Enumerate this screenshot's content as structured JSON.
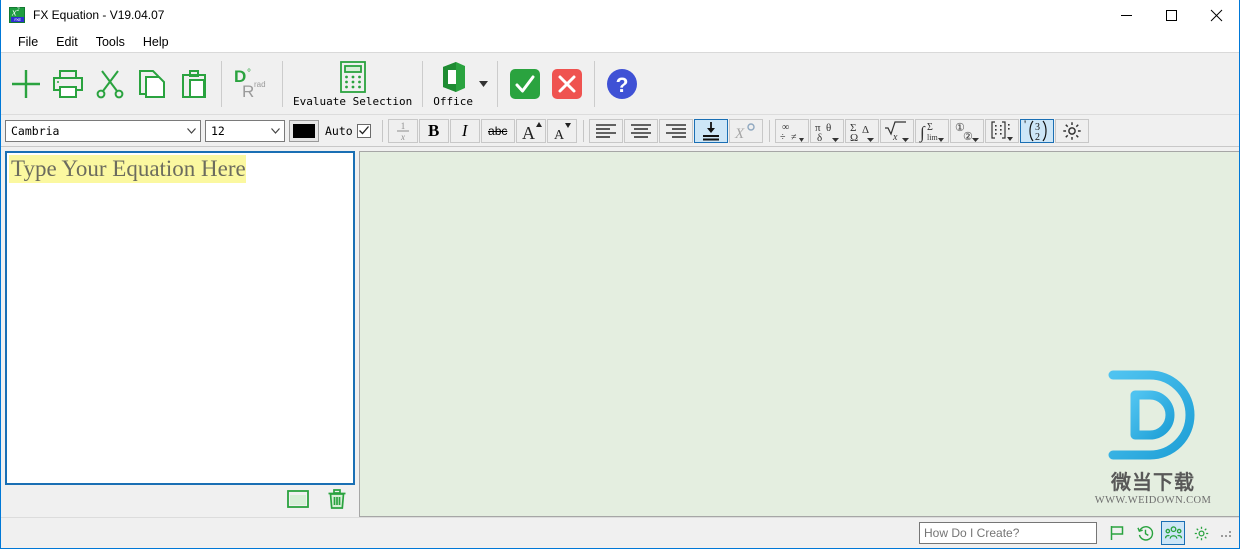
{
  "window": {
    "title": "FX Equation - V19.04.07",
    "app_icon": "fx-equation-icon",
    "minimize": "minimize",
    "maximize": "maximize",
    "close": "close"
  },
  "menu": {
    "items": [
      {
        "label": "File"
      },
      {
        "label": "Edit"
      },
      {
        "label": "Tools"
      },
      {
        "label": "Help"
      }
    ]
  },
  "toolbar": {
    "new_label": "",
    "print_label": "",
    "cut_label": "",
    "copy_label": "",
    "paste_label": "",
    "angle_mode": {
      "degrees": "D",
      "degree_symbol": "°",
      "radians": "R",
      "radian_label": "rad"
    },
    "evaluate_label": "Evaluate Selection",
    "office_label": "Office",
    "accept_label": "",
    "cancel_label": "",
    "help_label": ""
  },
  "formatbar": {
    "font_name": "Cambria",
    "font_size": "12",
    "color_value": "#000000",
    "auto_label": "Auto",
    "auto_checked": true,
    "bold_label": "B",
    "italic_label": "I",
    "strike_label": "abc",
    "grow_label": "A",
    "shrink_label": "A",
    "superscript_label": "X",
    "degree_label": "°",
    "fraction_numerator": "1",
    "fraction_denominator": "x",
    "symbols": {
      "operators": [
        "∞",
        "÷",
        "≠"
      ],
      "greek_lower": [
        "π",
        "θ",
        "δ"
      ],
      "greek_upper": [
        "Σ",
        "Ω",
        "Δ"
      ],
      "roots": [
        "√x",
        "x"
      ],
      "calculus": [
        "∫",
        "Σ",
        "lim"
      ],
      "circled": [
        "①",
        "②"
      ],
      "matrix": "matrix"
    },
    "binomial": {
      "top": "3",
      "bottom": "2"
    },
    "settings_label": ""
  },
  "editor": {
    "placeholder_text": "Type Your Equation Here",
    "highlight_color": "#fbf8a0",
    "text_color": "#6c6c5e",
    "border_color": "#1a6fb4",
    "font": "Cambria"
  },
  "left_tools": {
    "window_button": "window",
    "delete_button": "delete"
  },
  "preview": {
    "background_color": "#e4eee0",
    "content": ""
  },
  "watermark": {
    "logo_letter": "D",
    "chinese_text": "微当下载",
    "url": "WWW.WEIDOWN.COM",
    "color": "#3cb4e8"
  },
  "statusbar": {
    "help_value": "",
    "help_placeholder": "How Do I Create?",
    "flag_label": "",
    "history_label": "",
    "people_label": "",
    "settings_label": ""
  },
  "colors": {
    "accent": "#1a6fb4",
    "green": "#2aa33f",
    "red": "#ef5350",
    "blue": "#3f51d5",
    "titlebar_border": "#0078d7",
    "toolbar_bg": "#f0f0f0"
  }
}
